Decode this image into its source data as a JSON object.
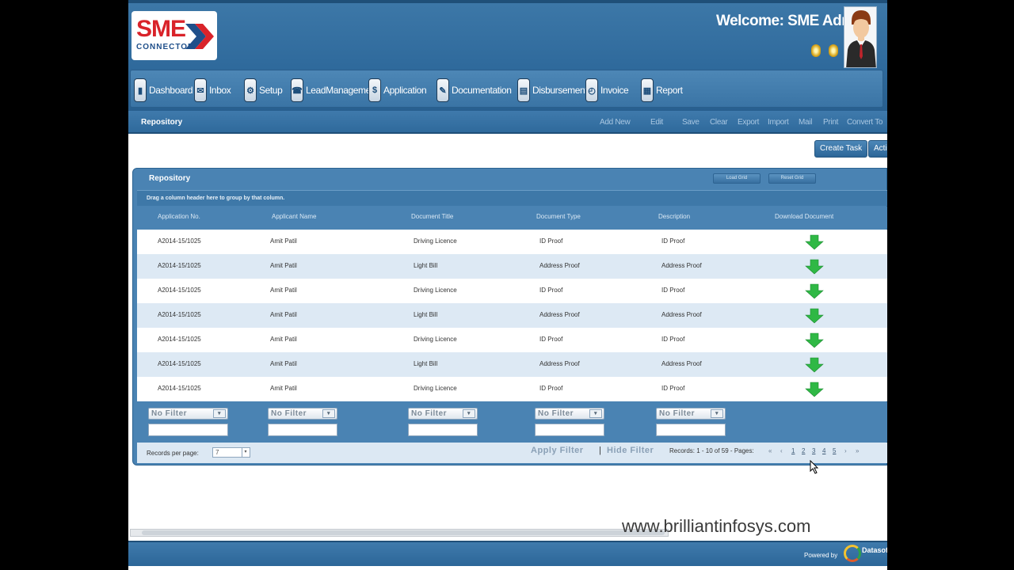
{
  "header": {
    "logo_text": "SME",
    "logo_subtext": "CONNECTOR",
    "welcome": "Welcome:  SME Admin"
  },
  "nav": [
    {
      "label": "Dashboard",
      "icon": "dashboard-icon"
    },
    {
      "label": "Inbox",
      "icon": "inbox-icon"
    },
    {
      "label": "Setup",
      "icon": "setup-icon"
    },
    {
      "label": "LeadManagement",
      "icon": "lead-management-icon"
    },
    {
      "label": "Application",
      "icon": "dollar-icon"
    },
    {
      "label": "Documentation",
      "icon": "documentation-icon"
    },
    {
      "label": "Disbursement",
      "icon": "disbursement-icon"
    },
    {
      "label": "Invoice",
      "icon": "invoice-icon"
    },
    {
      "label": "Report",
      "icon": "report-icon"
    }
  ],
  "toolbar": {
    "title": "Repository",
    "buttons": [
      "Add New",
      "Edit",
      "Save",
      "Clear",
      "Export",
      "Import",
      "Mail",
      "Print",
      "Convert To"
    ]
  },
  "actions": {
    "create_task": "Create Task",
    "partial": "Acti"
  },
  "grid": {
    "title": "Repository",
    "panel_btn_1": "Load Grid",
    "panel_btn_2": "Reset Grid",
    "group_hint": "Drag a column header here to group by that column.",
    "columns": [
      "Application No.",
      "Applicant Name",
      "Document Title",
      "Document Type",
      "Description",
      "Download Document"
    ],
    "rows": [
      [
        "A2014-15/1025",
        "Amit Patil",
        "Driving Licence",
        "ID Proof",
        "ID Proof"
      ],
      [
        "A2014-15/1025",
        "Amit Patil",
        "Light Bill",
        "Address Proof",
        "Address Proof"
      ],
      [
        "A2014-15/1025",
        "Amit Patil",
        "Driving Licence",
        "ID Proof",
        "ID Proof"
      ],
      [
        "A2014-15/1025",
        "Amit Patil",
        "Light Bill",
        "Address Proof",
        "Address Proof"
      ],
      [
        "A2014-15/1025",
        "Amit Patil",
        "Driving Licence",
        "ID Proof",
        "ID Proof"
      ],
      [
        "A2014-15/1025",
        "Amit Patil",
        "Light Bill",
        "Address Proof",
        "Address Proof"
      ],
      [
        "A2014-15/1025",
        "Amit Patil",
        "Driving Licence",
        "ID Proof",
        "ID Proof"
      ]
    ],
    "filter_label": "No Filter",
    "records_per_page_label": "Records per page:",
    "records_per_page_value": "7",
    "apply_filter": "Apply Filter",
    "separator": "|",
    "hide_filter": "Hide Filter",
    "records_info": "Records: 1 - 10 of 59 - Pages:",
    "pages": [
      "1",
      "2",
      "3",
      "4",
      "5"
    ],
    "pager_first": "«",
    "pager_prev": "‹",
    "pager_next": "›",
    "pager_last": "»"
  },
  "footer": {
    "powered_by": "Powered by",
    "brand": "Datasoft"
  },
  "watermark": "www.brilliantinfosys.com",
  "colors": {
    "primary": "#2f6a9c",
    "row_alt": "#dde9f4",
    "download_arrow": "#2fb845"
  }
}
